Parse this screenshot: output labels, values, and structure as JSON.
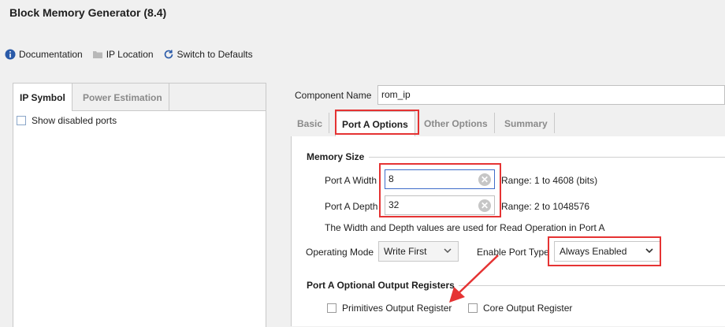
{
  "window": {
    "title": "Block Memory Generator (8.4)"
  },
  "toolbar": {
    "documentation": "Documentation",
    "ip_location": "IP Location",
    "switch_defaults": "Switch to Defaults"
  },
  "left_panel": {
    "tabs": [
      "IP Symbol",
      "Power Estimation"
    ],
    "show_disabled_ports": "Show disabled ports"
  },
  "component": {
    "label": "Component Name",
    "value": "rom_ip"
  },
  "tabs": [
    "Basic",
    "Port A Options",
    "Other Options",
    "Summary"
  ],
  "memory_size": {
    "title": "Memory Size",
    "width_label": "Port A Width",
    "width_value": "8",
    "width_range": "Range: 1 to 4608 (bits)",
    "depth_label": "Port A Depth",
    "depth_value": "32",
    "depth_range": "Range: 2 to 1048576",
    "note": "The Width and Depth values are used for Read Operation in Port A"
  },
  "operating_mode": {
    "label": "Operating Mode",
    "value": "Write First"
  },
  "enable_port_type": {
    "label": "Enable Port Type",
    "value": "Always Enabled"
  },
  "output_registers": {
    "title": "Port A Optional Output Registers",
    "primitives": "Primitives Output Register",
    "core": "Core Output Register"
  },
  "colors": {
    "annotation_red": "#e53333",
    "focus_blue": "#3f6dc9"
  }
}
